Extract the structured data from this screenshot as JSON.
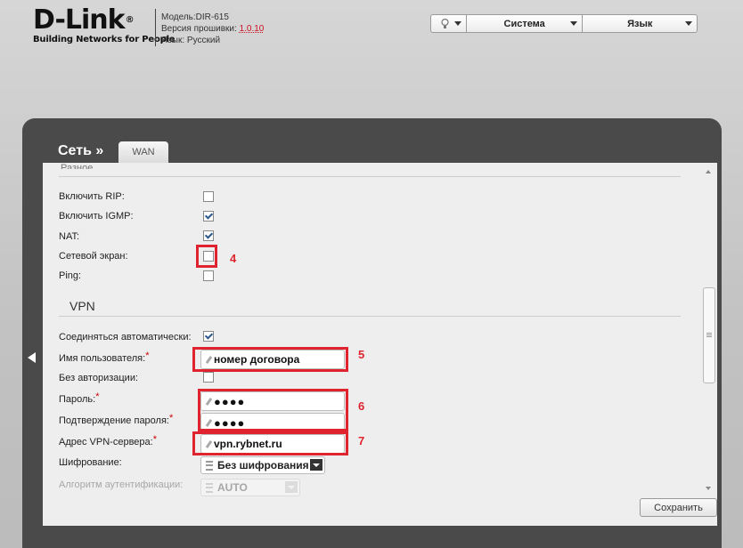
{
  "brand": {
    "name": "D-Link",
    "registered": "®",
    "tagline": "Building Networks for People"
  },
  "device": {
    "model": "Модель:DIR-615",
    "firmware_label": "Версия прошивки: ",
    "firmware_value": "1.0.10",
    "language": "Язык: Русский"
  },
  "topnav": {
    "system": "Система",
    "language": "Язык"
  },
  "breadcrumb": {
    "section": "Сеть »",
    "tab": "WAN"
  },
  "form": {
    "cut_label": "Разное",
    "rows": [
      {
        "label": "Включить RIP:",
        "checked": false
      },
      {
        "label": "Включить IGMP:",
        "checked": true
      },
      {
        "label": "NAT:",
        "checked": true
      },
      {
        "label": "Сетевой экран:",
        "checked": false
      },
      {
        "label": "Ping:",
        "checked": false
      }
    ],
    "vpn_section": "VPN",
    "connect_auto_label": "Соединяться автоматически:",
    "username_label": "Имя пользователя:",
    "username_value": "номер договора",
    "no_auth_label": "Без авторизации:",
    "password_label": "Пароль:",
    "password_value": "●●●●",
    "confirm_label": "Подтверждение пароля:",
    "confirm_value": "●●●●",
    "server_label": "Адрес VPN-сервера:",
    "server_value": "vpn.rybnet.ru",
    "encryption_label": "Шифрование:",
    "encryption_value": "Без шифрования",
    "auth_algo_label": "Алгоритм аутентификации:",
    "auth_algo_value": "AUTO",
    "required_mark": "*"
  },
  "annotations": {
    "n4": "4",
    "n5": "5",
    "n6": "6",
    "n7": "7"
  },
  "actions": {
    "save": "Сохранить"
  },
  "colors": {
    "highlight": "#e0242f",
    "panel": "#4a4a4a",
    "firmware_link": "#cc1122"
  }
}
